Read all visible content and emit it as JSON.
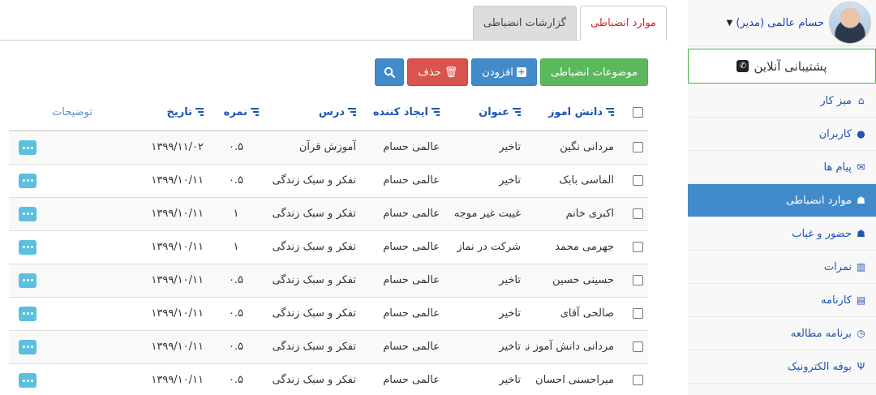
{
  "user": {
    "name": "حسام عالمی (مدیر)"
  },
  "sidebar": {
    "support_label": "پشتیبانی آنلاین",
    "items": [
      {
        "label": "میز کار",
        "icon": "home-icon",
        "glyph": "⌂",
        "active": false
      },
      {
        "label": "کاربران",
        "icon": "user-icon",
        "glyph": "●",
        "active": false
      },
      {
        "label": "پیام ها",
        "icon": "envelope-icon",
        "glyph": "✉",
        "active": false
      },
      {
        "label": "موارد انضباطی",
        "icon": "users-icon",
        "glyph": "☗",
        "active": true
      },
      {
        "label": "حضور و غیاب",
        "icon": "users-icon",
        "glyph": "☗",
        "active": false
      },
      {
        "label": "نمرات",
        "icon": "bar-chart-icon",
        "glyph": "▥",
        "active": false
      },
      {
        "label": "کارنامه",
        "icon": "list-alt-icon",
        "glyph": "▤",
        "active": false
      },
      {
        "label": "برنامه مطالعه",
        "icon": "clock-icon",
        "glyph": "◷",
        "active": false
      },
      {
        "label": "بوفه الکترونیک",
        "icon": "cutlery-icon",
        "glyph": "Ψ",
        "active": false
      }
    ]
  },
  "tabs": [
    {
      "label": "موارد انضباطی",
      "active": true
    },
    {
      "label": "گزارشات انضباطی",
      "active": false
    }
  ],
  "toolbar": {
    "topics_label": "موضوعات انضباطی",
    "add_label": "افزودن",
    "delete_label": "حذف"
  },
  "table": {
    "headers": {
      "student": "دانش اموز",
      "title": "عنوان",
      "creator": "ایجاد کننده",
      "course": "درس",
      "score": "نمره",
      "date": "تاریخ",
      "desc": "توضیحات"
    },
    "rows": [
      {
        "student": "مردانی نگین",
        "title": "تاخیر",
        "creator": "عالمی حسام",
        "course": "آموزش قرآن",
        "score": "۰.۵",
        "date": "۱۳۹۹/۱۱/۰۲"
      },
      {
        "student": "الماسی بابک",
        "title": "تاخیر",
        "creator": "عالمی حسام",
        "course": "تفکر و سبک زندگی",
        "score": "۰.۵",
        "date": "۱۳۹۹/۱۰/۱۱"
      },
      {
        "student": "اکبری خانم",
        "title": "غیبت غیر موجه",
        "creator": "عالمی حسام",
        "course": "تفکر و سبک زندگی",
        "score": "۱",
        "date": "۱۳۹۹/۱۰/۱۱"
      },
      {
        "student": "جهرمی محمد",
        "title": "شرکت در نماز",
        "creator": "عالمی حسام",
        "course": "تفکر و سبک زندگی",
        "score": "۱",
        "date": "۱۳۹۹/۱۰/۱۱"
      },
      {
        "student": "حسینی حسین",
        "title": "تاخیر",
        "creator": "عالمی حسام",
        "course": "تفکر و سبک زندگی",
        "score": "۰.۵",
        "date": "۱۳۹۹/۱۰/۱۱"
      },
      {
        "student": "صالحی آقای",
        "title": "تاخیر",
        "creator": "عالمی حسام",
        "course": "تفکر و سبک زندگی",
        "score": "۰.۵",
        "date": "۱۳۹۹/۱۰/۱۱"
      },
      {
        "student": "مردانی دانش آموز نیلوفر",
        "title": "تاخیر",
        "creator": "عالمی حسام",
        "course": "تفکر و سبک زندگی",
        "score": "۰.۵",
        "date": "۱۳۹۹/۱۰/۱۱"
      },
      {
        "student": "میراحسنی احسان",
        "title": "تاخیر",
        "creator": "عالمی حسام",
        "course": "تفکر و سبک زندگی",
        "score": "۰.۵",
        "date": "۱۳۹۹/۱۰/۱۱"
      }
    ]
  },
  "colors": {
    "accent_blue": "#428bca",
    "success_green": "#5cb85c",
    "danger_red": "#d9534f",
    "info_cyan": "#5bc0de",
    "active_tab_text": "#d9232d"
  }
}
